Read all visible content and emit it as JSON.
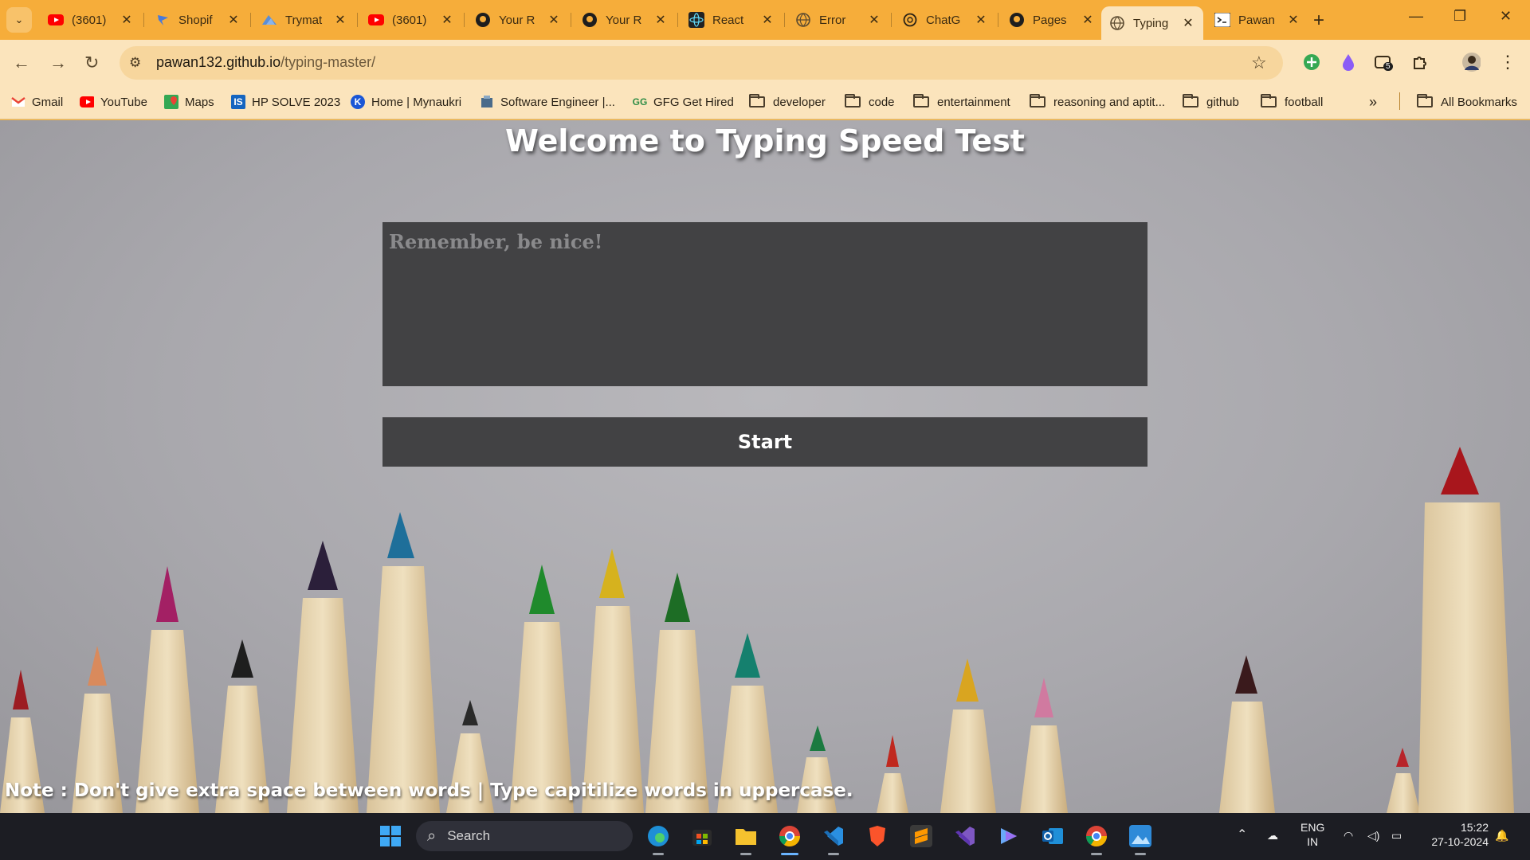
{
  "browser": {
    "tabs": [
      {
        "title": "(3601)",
        "icon": "youtube-icon"
      },
      {
        "title": "Shopif",
        "icon": "shopify-icon"
      },
      {
        "title": "Trymat",
        "icon": "trymata-icon"
      },
      {
        "title": "(3601)",
        "icon": "youtube-icon"
      },
      {
        "title": "Your R",
        "icon": "github-icon"
      },
      {
        "title": "Your R",
        "icon": "github-icon"
      },
      {
        "title": "React",
        "icon": "react-icon"
      },
      {
        "title": "Error",
        "icon": "globe-icon"
      },
      {
        "title": "ChatG",
        "icon": "chatgpt-icon"
      },
      {
        "title": "Pages",
        "icon": "github-icon"
      },
      {
        "title": "Typing",
        "icon": "globe-icon",
        "active": true
      },
      {
        "title": "Pawan",
        "icon": "terminal-icon"
      }
    ],
    "url_host": "pawan132.github.io",
    "url_path": "/typing-master/",
    "extension_badge": "5",
    "bookmarks": [
      {
        "label": "Gmail",
        "icon": "gmail-icon"
      },
      {
        "label": "YouTube",
        "icon": "youtube-icon"
      },
      {
        "label": "Maps",
        "icon": "maps-icon"
      },
      {
        "label": "HP SOLVE 2023",
        "icon": "hp-solve-icon"
      },
      {
        "label": "Home | Mynaukri",
        "icon": "mynaukri-icon"
      },
      {
        "label": "Software Engineer |...",
        "icon": "job-icon"
      },
      {
        "label": "GFG Get Hired",
        "icon": "gfg-icon"
      },
      {
        "label": "developer",
        "icon": "folder-icon"
      },
      {
        "label": "code",
        "icon": "folder-icon"
      },
      {
        "label": "entertainment",
        "icon": "folder-icon"
      },
      {
        "label": "reasoning and aptit...",
        "icon": "folder-icon"
      },
      {
        "label": "github",
        "icon": "folder-icon"
      },
      {
        "label": "football",
        "icon": "folder-icon"
      }
    ],
    "all_bookmarks": "All Bookmarks",
    "theme_color": "#f6ad3a"
  },
  "page": {
    "title": "Welcome to Typing Speed Test",
    "textarea_placeholder": "Remember, be nice!",
    "start_label": "Start",
    "note": "Note : Don't give extra space between words | Type capitilize words in uppercase.",
    "panel_color": "#424244"
  },
  "taskbar": {
    "search_label": "Search",
    "language_top": "ENG",
    "language_bottom": "IN",
    "time": "15:22",
    "date": "27-10-2024",
    "apps": [
      "windows-start-icon",
      "edge-icon",
      "store-icon",
      "file-explorer-icon",
      "chrome-icon",
      "vscode-icon",
      "brave-icon",
      "sublime-icon",
      "visual-studio-icon",
      "copilot-icon",
      "outlook-icon",
      "chrome-canary-icon",
      "photos-icon"
    ]
  }
}
